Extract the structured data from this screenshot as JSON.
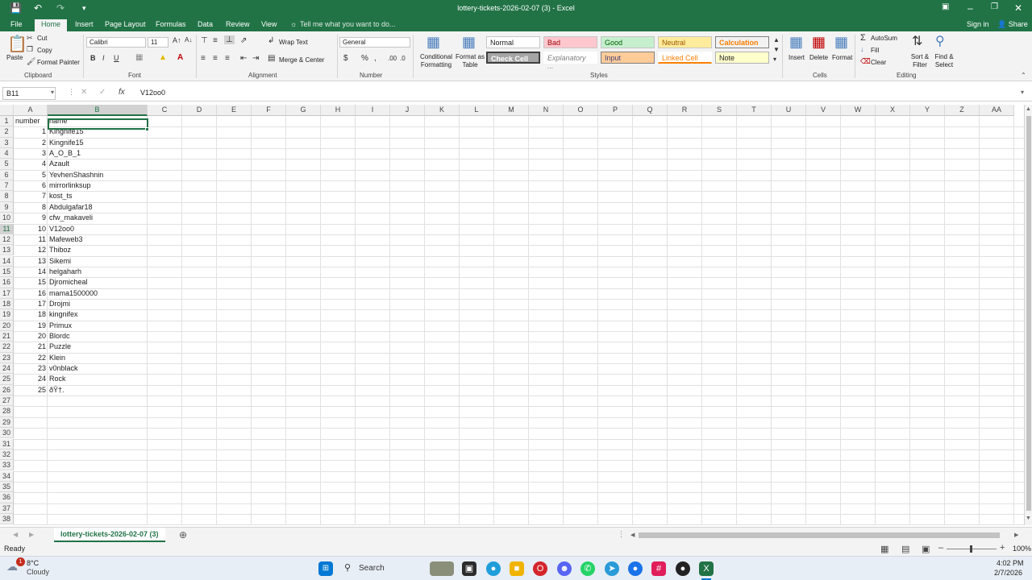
{
  "window": {
    "title": "lottery-tickets-2026-02-07 (3) - Excel",
    "sign_in": "Sign in",
    "share": "Share"
  },
  "ribbon_tabs": [
    "File",
    "Home",
    "Insert",
    "Page Layout",
    "Formulas",
    "Data",
    "Review",
    "View"
  ],
  "tell_me": "Tell me what you want to do...",
  "ribbon": {
    "clipboard": {
      "paste": "Paste",
      "cut": "Cut",
      "copy": "Copy",
      "format_painter": "Format Painter",
      "label": "Clipboard"
    },
    "font": {
      "name": "Calibri",
      "size": "11",
      "bold": "B",
      "italic": "I",
      "underline": "U",
      "label": "Font"
    },
    "alignment": {
      "wrap_text": "Wrap Text",
      "merge_center": "Merge & Center",
      "label": "Alignment"
    },
    "number": {
      "format": "General",
      "currency": "$",
      "percent": "%",
      "comma": ",",
      "label": "Number"
    },
    "styles": {
      "conditional": "Conditional Formatting",
      "format_as_table": "Format as Table",
      "normal": "Normal",
      "bad": "Bad",
      "good": "Good",
      "neutral": "Neutral",
      "calculation": "Calculation",
      "check_cell": "Check Cell",
      "explanatory": "Explanatory ...",
      "input": "Input",
      "linked_cell": "Linked Cell",
      "note": "Note",
      "label": "Styles"
    },
    "cells": {
      "insert": "Insert",
      "delete": "Delete",
      "format": "Format",
      "label": "Cells"
    },
    "editing": {
      "autosum": "AutoSum",
      "fill": "Fill",
      "clear": "Clear",
      "sort_filter": "Sort & Filter",
      "find_select": "Find & Select",
      "label": "Editing"
    }
  },
  "formula_bar": {
    "name_box": "B11",
    "content": "V12oo0"
  },
  "columns": [
    "A",
    "B",
    "C",
    "D",
    "E",
    "F",
    "G",
    "H",
    "I",
    "J",
    "K",
    "L",
    "M",
    "N",
    "O",
    "P",
    "Q",
    "R",
    "S",
    "T",
    "U",
    "V",
    "W",
    "X",
    "Y",
    "Z",
    "AA"
  ],
  "row_numbers": [
    "1",
    "2",
    "3",
    "4",
    "5",
    "6",
    "7",
    "8",
    "9",
    "10",
    "11",
    "12",
    "13",
    "14",
    "15",
    "16",
    "17",
    "18",
    "19",
    "20",
    "21",
    "22",
    "23",
    "24",
    "25",
    "26",
    "27",
    "28",
    "29",
    "30",
    "31",
    "32",
    "33",
    "34",
    "35",
    "36",
    "37",
    "38"
  ],
  "header_row": {
    "a": "number",
    "b": "name"
  },
  "rows": [
    {
      "number": "1",
      "name": "Kingnife15"
    },
    {
      "number": "2",
      "name": "Kingnife15"
    },
    {
      "number": "3",
      "name": "A_O_B_1"
    },
    {
      "number": "4",
      "name": "Azault"
    },
    {
      "number": "5",
      "name": "YevhenShashnin"
    },
    {
      "number": "6",
      "name": "mirrorlinksup"
    },
    {
      "number": "7",
      "name": "kost_ts"
    },
    {
      "number": "8",
      "name": "Abdulgafar18"
    },
    {
      "number": "9",
      "name": "cfw_makaveli"
    },
    {
      "number": "10",
      "name": "V12oo0"
    },
    {
      "number": "11",
      "name": "Mafeweb3"
    },
    {
      "number": "12",
      "name": "Thiboz"
    },
    {
      "number": "13",
      "name": "Sikemi"
    },
    {
      "number": "14",
      "name": "helgaharh"
    },
    {
      "number": "15",
      "name": "Djromicheal"
    },
    {
      "number": "16",
      "name": "mama1500000"
    },
    {
      "number": "17",
      "name": "Drojmi"
    },
    {
      "number": "18",
      "name": "kingnifex"
    },
    {
      "number": "19",
      "name": "Primux"
    },
    {
      "number": "20",
      "name": "Blordc"
    },
    {
      "number": "21",
      "name": "Puzzle"
    },
    {
      "number": "22",
      "name": "Klein"
    },
    {
      "number": "23",
      "name": "v0nblack"
    },
    {
      "number": "24",
      "name": "Rock"
    },
    {
      "number": "25",
      "name": "ðŸ†."
    }
  ],
  "sheet_tab": "lottery-tickets-2026-02-07 (3)",
  "status": {
    "ready": "Ready",
    "zoom": "100%"
  },
  "taskbar": {
    "weather_temp": "8°C",
    "weather_desc": "Cloudy",
    "search": "Search",
    "time": "4:02 PM",
    "date": "2/7/2026",
    "badge": "1"
  },
  "colors": {
    "accent": "#217346",
    "bad_bg": "#ffc7ce",
    "good_bg": "#c6efce",
    "neutral_bg": "#ffeb9c",
    "input_bg": "#ffcc99",
    "note_bg": "#ffffcc"
  }
}
